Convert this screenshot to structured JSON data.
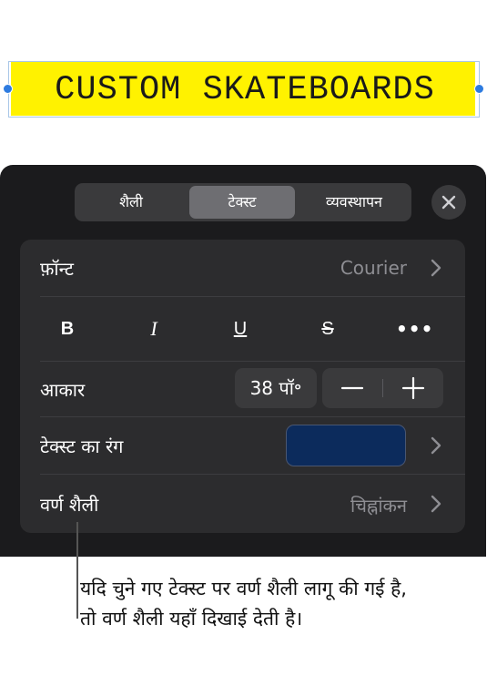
{
  "canvas": {
    "text_box_text": "CUSTOM SKATEBOARDS",
    "highlight_color": "#fff200"
  },
  "panel": {
    "tabs": [
      {
        "label": "शैली"
      },
      {
        "label": "टेक्स्ट",
        "selected": true
      },
      {
        "label": "व्यवस्थापन"
      }
    ],
    "close_icon": "close-icon",
    "font": {
      "label": "फ़ॉन्ट",
      "value": "Courier"
    },
    "format_buttons": {
      "bold": "B",
      "italic": "I",
      "underline": "U",
      "strike": "S",
      "more": "•••"
    },
    "size": {
      "label": "आकार",
      "value": "38 पॉ॰"
    },
    "text_color": {
      "label": "टेक्स्ट का रंग",
      "swatch": "#0c2b5c"
    },
    "char_style": {
      "label": "वर्ण शैली",
      "value": "चिह्नांकन"
    }
  },
  "callout": {
    "text": "यदि चुने गए टेक्स्ट पर वर्ण शैली लागू की गई है, तो वर्ण शैली यहाँ दिखाई देती है।"
  }
}
